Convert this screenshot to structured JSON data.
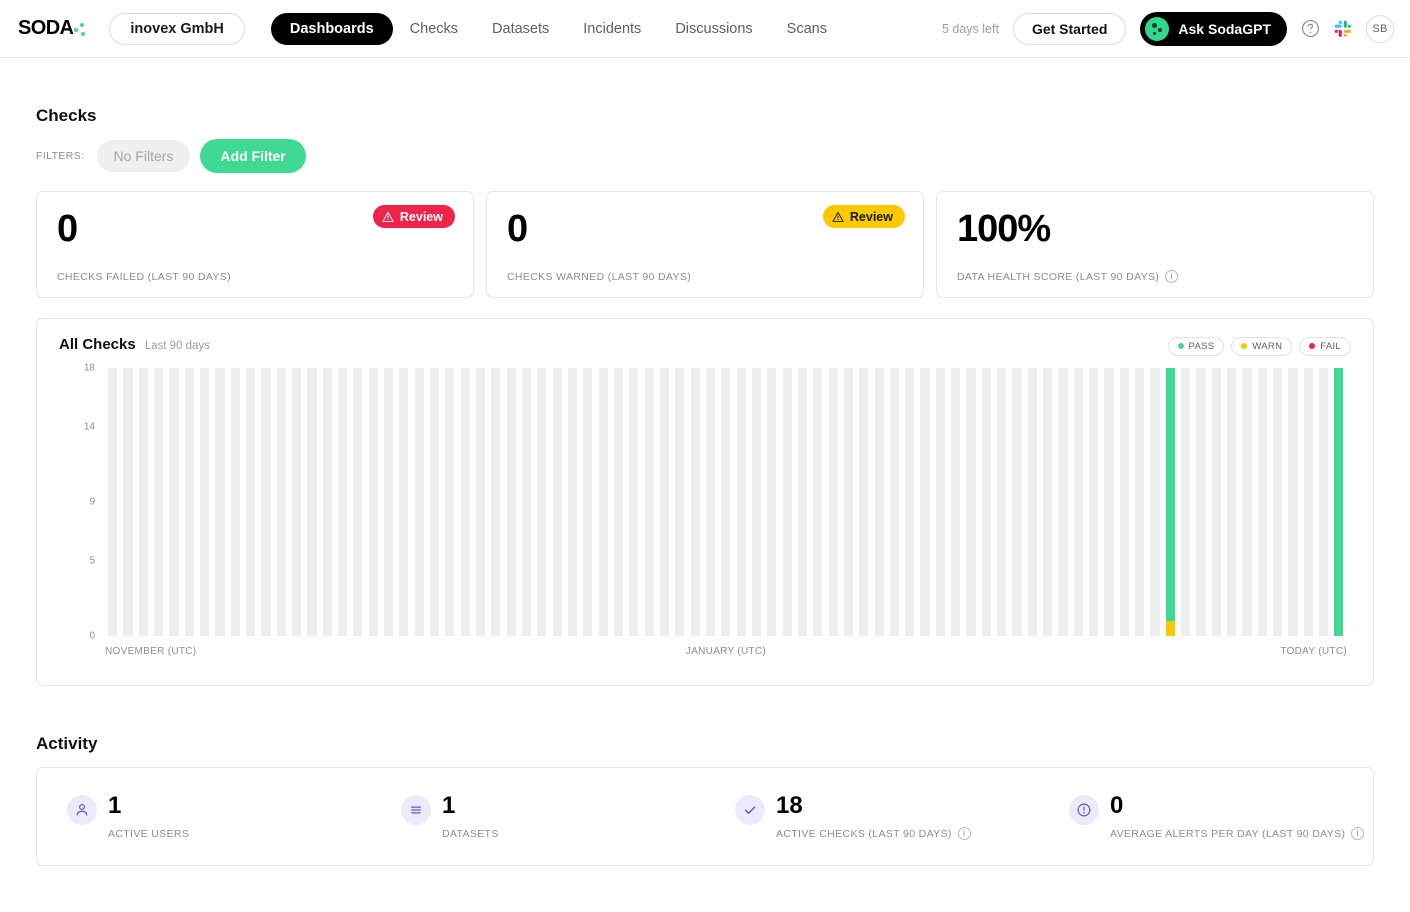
{
  "header": {
    "logo_text": "SODA",
    "logo_icon": "soda-logo-dots",
    "org_name": "inovex GmbH",
    "nav": [
      {
        "label": "Dashboards",
        "active": true
      },
      {
        "label": "Checks",
        "active": false
      },
      {
        "label": "Datasets",
        "active": false
      },
      {
        "label": "Incidents",
        "active": false
      },
      {
        "label": "Discussions",
        "active": false
      },
      {
        "label": "Scans",
        "active": false
      }
    ],
    "days_left": "5 days left",
    "get_started": "Get Started",
    "ask_sodagpt": "Ask SodaGPT",
    "help_icon": "help-circle-icon",
    "slack_icon": "slack-icon",
    "avatar_initials": "SB"
  },
  "checks": {
    "title": "Checks",
    "filters_label": "FILTERS:",
    "no_filters": "No Filters",
    "add_filter": "Add Filter",
    "cards": [
      {
        "value": "0",
        "label": "CHECKS FAILED (LAST 90 DAYS)",
        "badge": "Review",
        "badge_kind": "fail",
        "badge_icon": "warning-triangle-icon",
        "has_info": false
      },
      {
        "value": "0",
        "label": "CHECKS WARNED (LAST 90 DAYS)",
        "badge": "Review",
        "badge_kind": "warn",
        "badge_icon": "warning-triangle-icon",
        "has_info": false
      },
      {
        "value": "100%",
        "label": "DATA HEALTH SCORE (LAST 90 DAYS)",
        "badge": null,
        "badge_kind": null,
        "badge_icon": null,
        "has_info": true
      }
    ]
  },
  "chart_card": {
    "title": "All Checks",
    "subtitle": "Last 90 days",
    "legend": [
      {
        "label": "PASS",
        "color": "#3fd994"
      },
      {
        "label": "WARN",
        "color": "#fcc800"
      },
      {
        "label": "FAIL",
        "color": "#f0244b"
      }
    ]
  },
  "chart_data": {
    "type": "bar",
    "title": "All Checks",
    "subtitle": "Last 90 days",
    "stacked": true,
    "xlabel": "",
    "ylabel": "",
    "ylim": [
      0,
      18
    ],
    "yticks": [
      0,
      5,
      9,
      14,
      18
    ],
    "ytick_labels": [
      "0",
      "5",
      "9",
      "14",
      "18"
    ],
    "grid": false,
    "legend_position": "top-right",
    "x_tick_labels": [
      "NOVEMBER (UTC)",
      "JANUARY (UTC)",
      "TODAY (UTC)"
    ],
    "x_tick_positions": [
      "left",
      "middle",
      "right"
    ],
    "n_bars": 81,
    "empty_color": "#eeeeec",
    "empty_bar_height": 18,
    "series": [
      {
        "name": "PASS",
        "color": "#3fd994"
      },
      {
        "name": "WARN",
        "color": "#fcc800"
      },
      {
        "name": "FAIL",
        "color": "#f0244b"
      }
    ],
    "bars": [
      {
        "index": 69,
        "pass": 17,
        "warn": 1,
        "fail": 0
      },
      {
        "index": 80,
        "pass": 18,
        "warn": 0,
        "fail": 0
      }
    ],
    "note": "All other bars are empty placeholders (no data) rendered in light grey at full height."
  },
  "activity": {
    "title": "Activity",
    "items": [
      {
        "value": "1",
        "label": "ACTIVE USERS",
        "icon": "user-icon",
        "has_info": false
      },
      {
        "value": "1",
        "label": "DATASETS",
        "icon": "list-icon",
        "has_info": false
      },
      {
        "value": "18",
        "label": "ACTIVE CHECKS (LAST 90 DAYS)",
        "icon": "check-icon",
        "has_info": true
      },
      {
        "value": "0",
        "label": "AVERAGE ALERTS PER DAY (LAST 90 DAYS)",
        "icon": "alert-circle-icon",
        "has_info": true
      }
    ]
  },
  "colors": {
    "pass": "#3fd994",
    "warn": "#fcc800",
    "fail": "#f0244b",
    "accent_purple": "#5b4fe0",
    "border": "#e6e6ea",
    "muted_text": "#8a8d93"
  }
}
